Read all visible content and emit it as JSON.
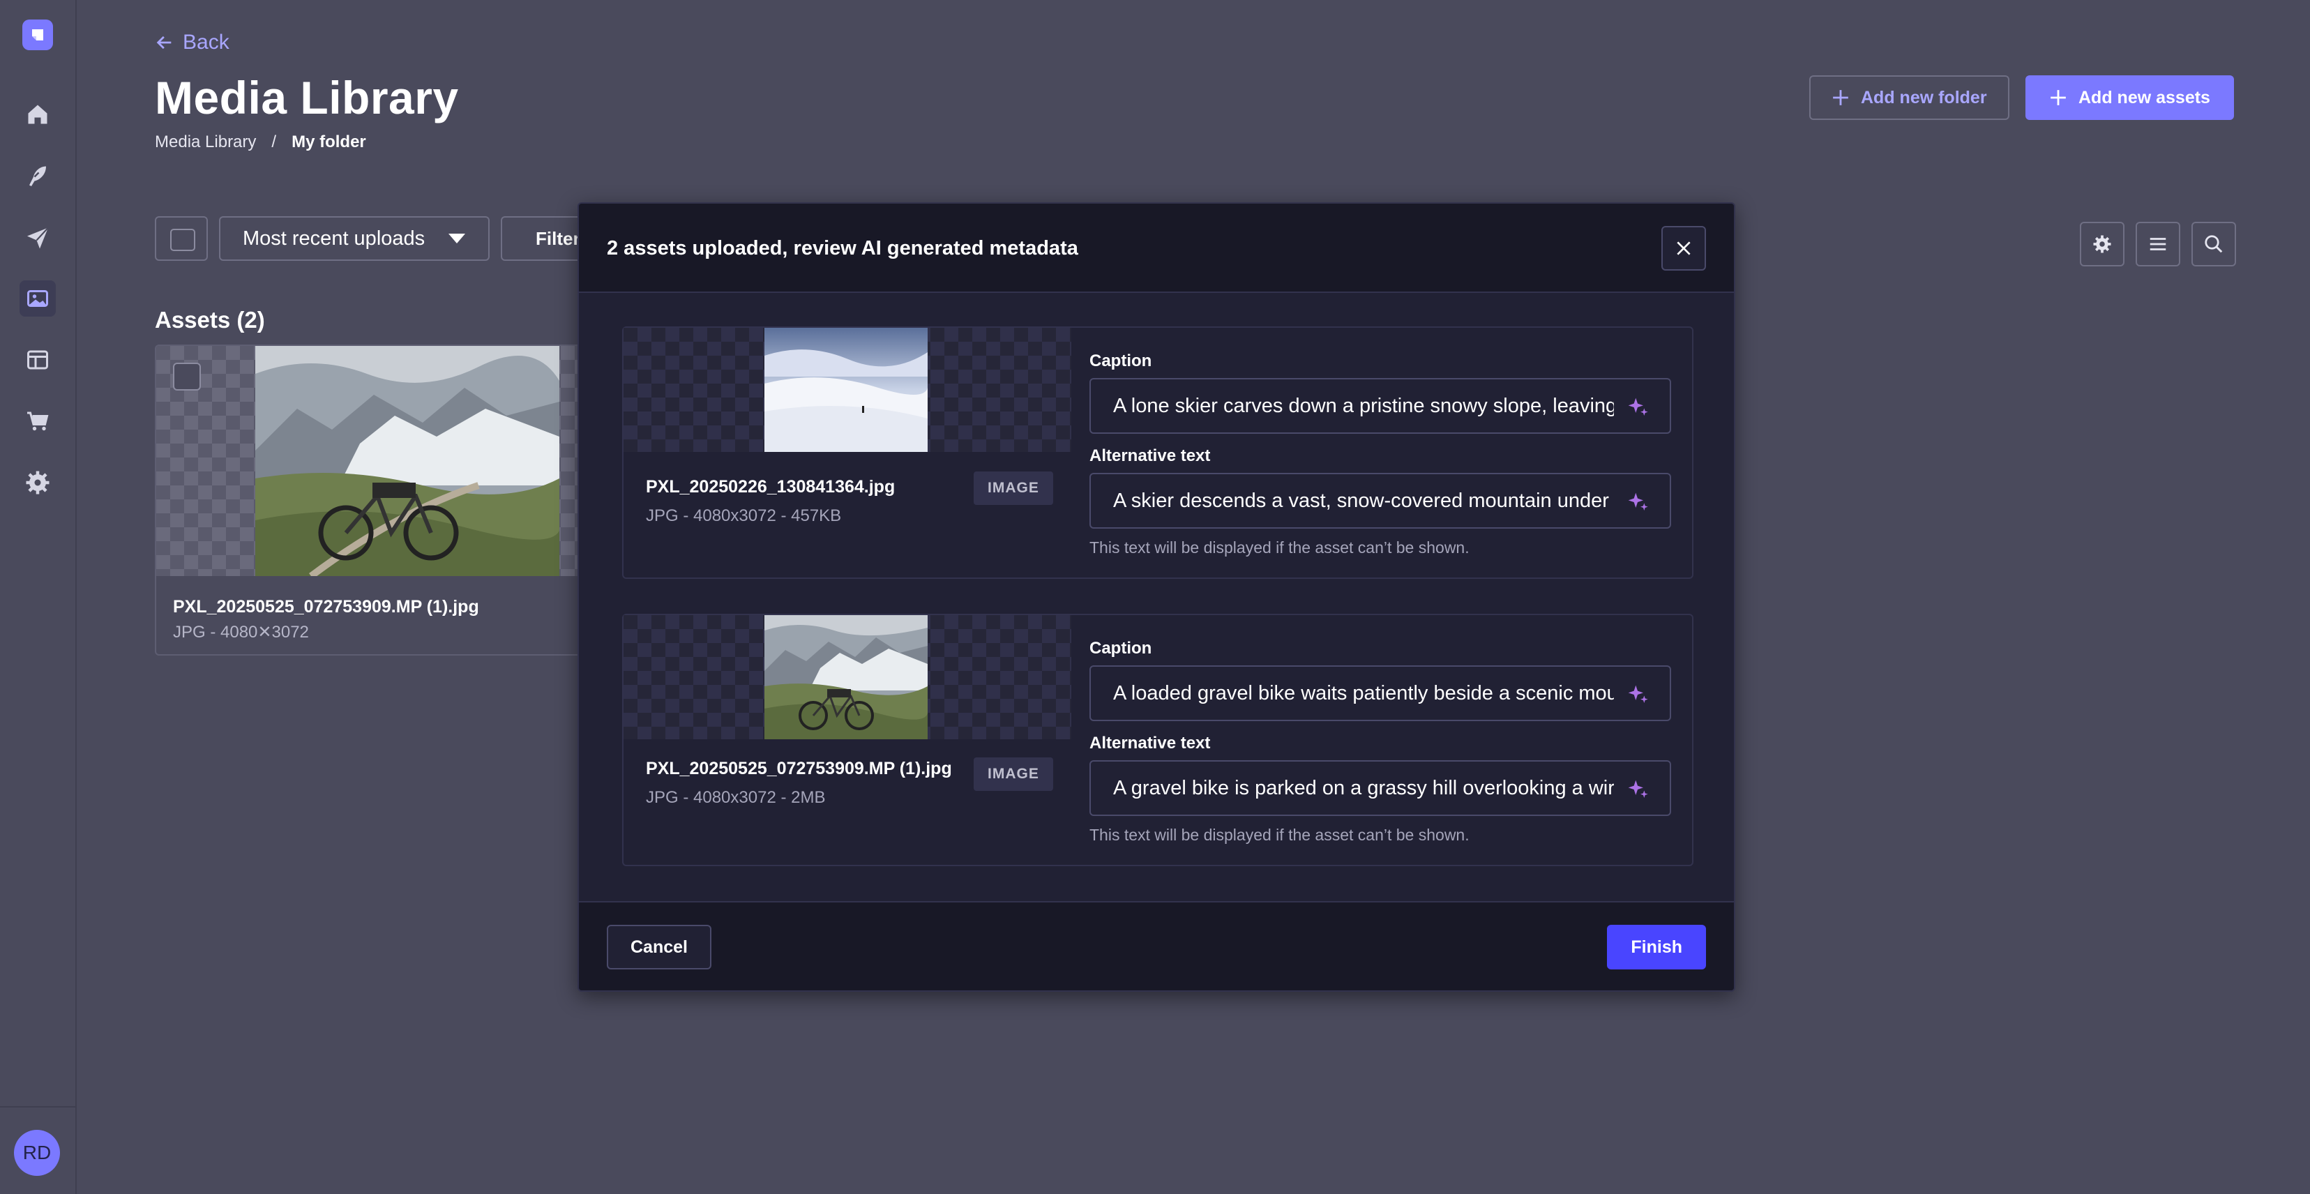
{
  "nav": {
    "items": [
      "home-icon",
      "content-manager-icon",
      "deploy-icon",
      "media-library-icon",
      "content-type-builder-icon",
      "marketplace-icon",
      "settings-icon"
    ],
    "active": "media-library-icon",
    "avatar_initials": "RD"
  },
  "header": {
    "back_label": "Back",
    "title": "Media Library",
    "breadcrumb": {
      "root": "Media Library",
      "separator": "/",
      "current": "My folder"
    },
    "add_folder_label": "Add new folder",
    "add_assets_label": "Add new assets"
  },
  "toolbar": {
    "sort_value": "Most recent uploads",
    "filters_label": "Filters"
  },
  "assets": {
    "heading": "Assets (2)",
    "items": [
      {
        "name": "PXL_20250525_072753909.MP (1).jpg",
        "meta": "JPG - 4080✕3072"
      }
    ]
  },
  "modal": {
    "title": "2 assets uploaded, review AI generated metadata",
    "cancel_label": "Cancel",
    "finish_label": "Finish",
    "caption_label": "Caption",
    "alt_label": "Alternative text",
    "alt_hint": "This text will be displayed if the asset can’t be shown.",
    "assets": [
      {
        "name": "PXL_20250226_130841364.jpg",
        "meta": "JPG - 4080x3072 - 457KB",
        "type": "IMAGE",
        "caption": "A lone skier carves down a pristine snowy slope, leaving",
        "alt": "A skier descends a vast, snow-covered mountain under"
      },
      {
        "name": "PXL_20250525_072753909.MP (1).jpg",
        "meta": "JPG - 4080x3072 - 2MB",
        "type": "IMAGE",
        "caption": "A loaded gravel bike waits patiently beside a scenic mou",
        "alt": "A gravel bike is parked on a grassy hill overlooking a wir"
      }
    ]
  },
  "colors": {
    "accent": "#7b79ff",
    "primary_button": "#4945ff",
    "modal_bg": "#212134",
    "overlay_bg": "#4a4a5c"
  }
}
